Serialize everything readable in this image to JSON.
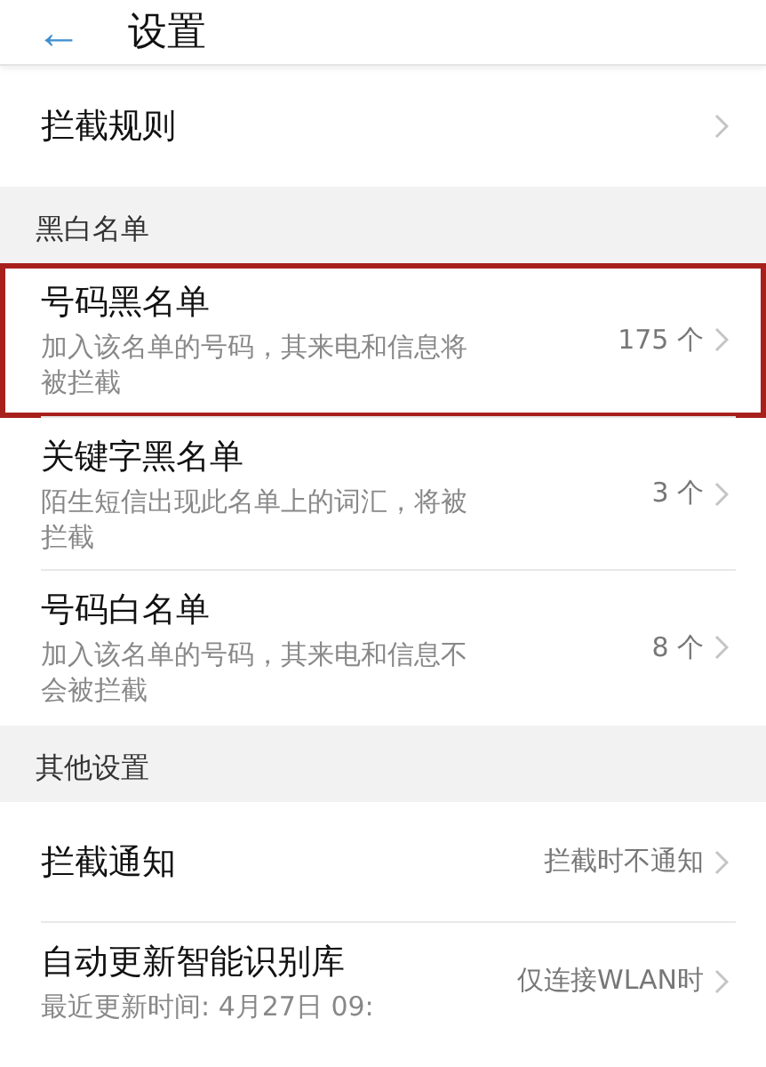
{
  "header": {
    "back": "←",
    "title": "设置"
  },
  "sections": [
    {
      "items": [
        {
          "title": "拦截规则",
          "highlighted": false
        }
      ]
    },
    {
      "heading": "黑白名单",
      "items": [
        {
          "title": "号码黑名单",
          "subtitle": "加入该名单的号码，其来电和信息将被拦截",
          "value": "175 个",
          "highlighted": true
        },
        {
          "title": "关键字黑名单",
          "subtitle": "陌生短信出现此名单上的词汇，将被拦截",
          "value": "3 个",
          "highlighted": false
        },
        {
          "title": "号码白名单",
          "subtitle": "加入该名单的号码，其来电和信息不会被拦截",
          "value": "8 个",
          "highlighted": false
        }
      ]
    },
    {
      "heading": "其他设置",
      "items": [
        {
          "title": "拦截通知",
          "value": "拦截时不通知",
          "highlighted": false
        },
        {
          "title": "自动更新智能识别库",
          "subtitle": "最近更新时间: 4月27日 09:",
          "value": "仅连接WLAN时",
          "highlighted": false
        }
      ]
    }
  ]
}
